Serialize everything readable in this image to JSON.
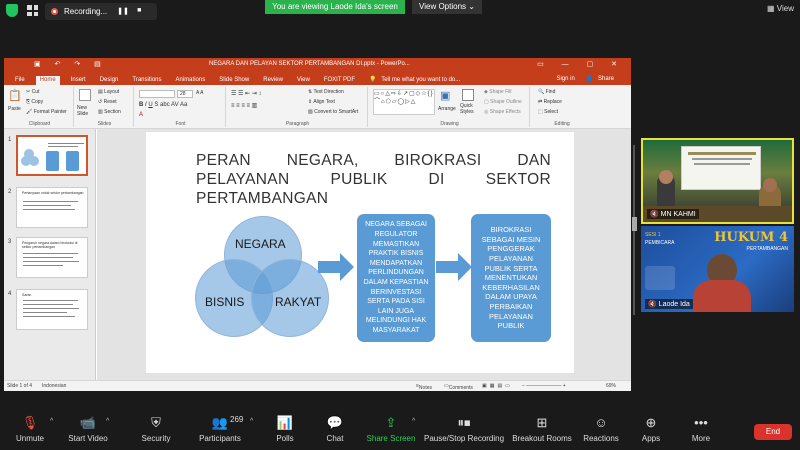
{
  "topbar": {
    "recording_label": "Recording...",
    "viewing_banner": "You are viewing Laode Ida's screen",
    "view_options": "View Options",
    "view_label": "View"
  },
  "ppt": {
    "title": "NEGARA DAN PELAYAN SEKTOR PERTAMBANGAN DI.pptx - PowerPo...",
    "menu": [
      "File",
      "Home",
      "Insert",
      "Design",
      "Transitions",
      "Animations",
      "Slide Show",
      "Review",
      "View",
      "FOXIT PDF"
    ],
    "tell_me": "Tell me what you want to do...",
    "signin": "Sign in",
    "share": "Share",
    "ribbon": {
      "clipboard": "Clipboard",
      "slides": "Slides",
      "font": "Font",
      "paragraph": "Paragraph",
      "drawing": "Drawing",
      "editing": "Editing",
      "paste": "Paste",
      "cut": "Cut",
      "copy": "Copy",
      "format_painter": "Format Painter",
      "new_slide": "New Slide",
      "layout": "Layout",
      "reset": "Reset",
      "section": "Section",
      "text_direction": "Text Direction",
      "align_text": "Align Text",
      "convert_smartart": "Convert to SmartArt",
      "arrange": "Arrange",
      "quick_styles": "Quick Styles",
      "shape_fill": "Shape Fill",
      "shape_outline": "Shape Outline",
      "shape_effects": "Shape Effects",
      "find": "Find",
      "replace": "Replace",
      "select": "Select",
      "font_size": "28"
    },
    "thumbnails": [
      {
        "num": "1"
      },
      {
        "num": "2",
        "title": "Pertanyaan untuk sektor pertambangan"
      },
      {
        "num": "3",
        "title": "Pengaruh negara dalam birokrasi di sektor pertambangan"
      },
      {
        "num": "4",
        "title": "Saran"
      }
    ],
    "slide": {
      "title": "PERAN NEGARA, BIROKRASI DAN PELAYANAN PUBLIK DI SEKTOR PERTAMBANGAN",
      "circles": [
        "NEGARA",
        "BISNIS",
        "RAKYAT"
      ],
      "box1": "NEGARA SEBAGAI REGULATOR MEMASTIKAN PRAKTIK BISNIS MENDAPATKAN PERLINDUNGAN DALAM KEPASTIAN BERINVESTASI SERTA PADA SISI LAIN JUGA MELINDUNGI HAK MASYARAKAT",
      "box2": "BIROKRASI SEBAGAI MESIN PENGGERAK PELAYANAN PUBLIK SERTA MENENTUKAN KEBERHASILAN DALAM UPAYA PERBAIKAN PELAYANAN PUBLIK"
    },
    "status": {
      "slide_of": "Slide 1 of 4",
      "language": "Indonesian",
      "notes": "Notes",
      "comments": "Comments",
      "zoom": "69%"
    },
    "colors": {
      "accent": "#c43e1c",
      "shape_blue": "#5b9bd5"
    }
  },
  "participants": [
    {
      "name": "MN KAHMI"
    },
    {
      "name": "Laode Ida"
    }
  ],
  "video_tile_texts": {
    "hukum": "HUKUM",
    "num": "4",
    "pertambangan": "PERTAMBANGAN",
    "sesi": "SESI 1",
    "pembicara": "PEMBICARA"
  },
  "toolbar": {
    "unmute": "Unmute",
    "start_video": "Start Video",
    "security": "Security",
    "participants": "Participants",
    "participant_count": "269",
    "polls": "Polls",
    "chat": "Chat",
    "share_screen": "Share Screen",
    "record": "Pause/Stop Recording",
    "breakout": "Breakout Rooms",
    "reactions": "Reactions",
    "apps": "Apps",
    "more": "More",
    "end": "End"
  }
}
